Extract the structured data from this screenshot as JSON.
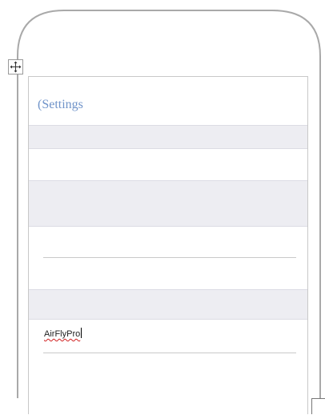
{
  "settings_screen": {
    "title": "(Settings"
  },
  "wifi_field": {
    "value": "AirFlyPro"
  },
  "icons": {
    "move_handle": "move-arrows-icon"
  },
  "colors": {
    "title_text": "#6f93c9",
    "shaded_band": "#ededf2",
    "spellcheck_underline": "#d02020",
    "frame_outline": "#a9a9a9"
  }
}
